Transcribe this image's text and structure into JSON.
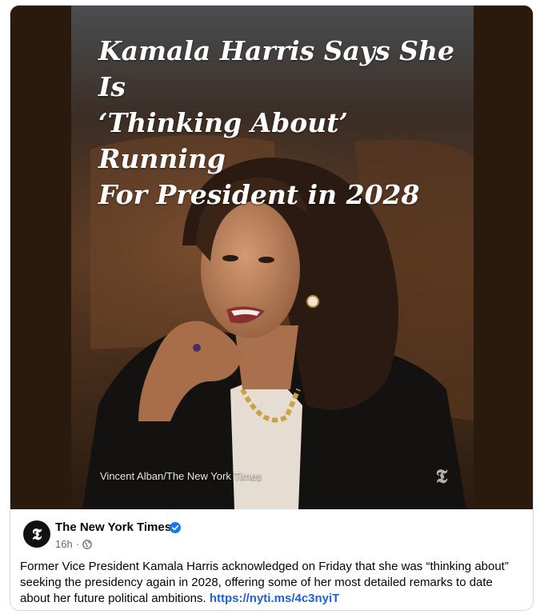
{
  "post": {
    "image": {
      "headline_lines": [
        "Kamala Harris Says She Is",
        "‘Thinking About’ Running",
        "For President in 2028"
      ],
      "credit": "Vincent Alban/The New York Times",
      "watermark_glyph": "𝕿"
    },
    "author": {
      "name": "The New York Times",
      "avatar_glyph": "𝕿",
      "verified": true,
      "verified_color": "#1877f2"
    },
    "meta": {
      "time": "16h",
      "separator": "·",
      "audience_icon": "globe-icon"
    },
    "caption": {
      "text": "Former Vice President Kamala Harris acknowledged on Friday that she was “thinking about” seeking the presidency again in 2028, offering some of her most detailed remarks to date about her future political ambitions.",
      "link": "https://nyti.ms/4c3nyiT"
    }
  }
}
